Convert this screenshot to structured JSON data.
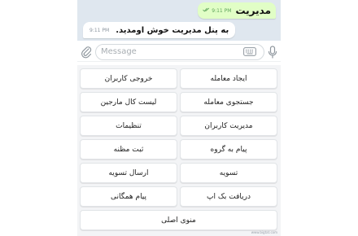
{
  "messages": {
    "outgoing": {
      "text": "مدیریت",
      "time": "9:11 PM",
      "status": "read-double-check-icon"
    },
    "incoming": {
      "text": "به پنل مدیریت خوش اومدید.",
      "time": "9:11 PM"
    }
  },
  "composer": {
    "placeholder": "Message",
    "icons": [
      "paperclip-icon",
      "keyboard-icon",
      "microphone-icon"
    ]
  },
  "keyboard": {
    "rows": [
      [
        "ایجاد معامله",
        "خروجی کاربران"
      ],
      [
        "جستجوی معامله",
        "لیست کال مارجین"
      ],
      [
        "مدیریت کاربران",
        "تنظیمات"
      ],
      [
        "پیام به گروه",
        "ثبت مظنه"
      ],
      [
        "تسویه",
        "ارسال تسویه"
      ],
      [
        "دریافت بک اپ",
        "پیام همگانی"
      ],
      [
        "منوی اصلی"
      ]
    ]
  },
  "watermark": "www.bigtat.com",
  "colors": {
    "chat_bg": "#dfe7ef",
    "outgoing_bubble": "#e1fec6",
    "incoming_bubble": "#ffffff",
    "keyboard_bg": "#f3f4f6",
    "check_color": "#5fa45c"
  }
}
